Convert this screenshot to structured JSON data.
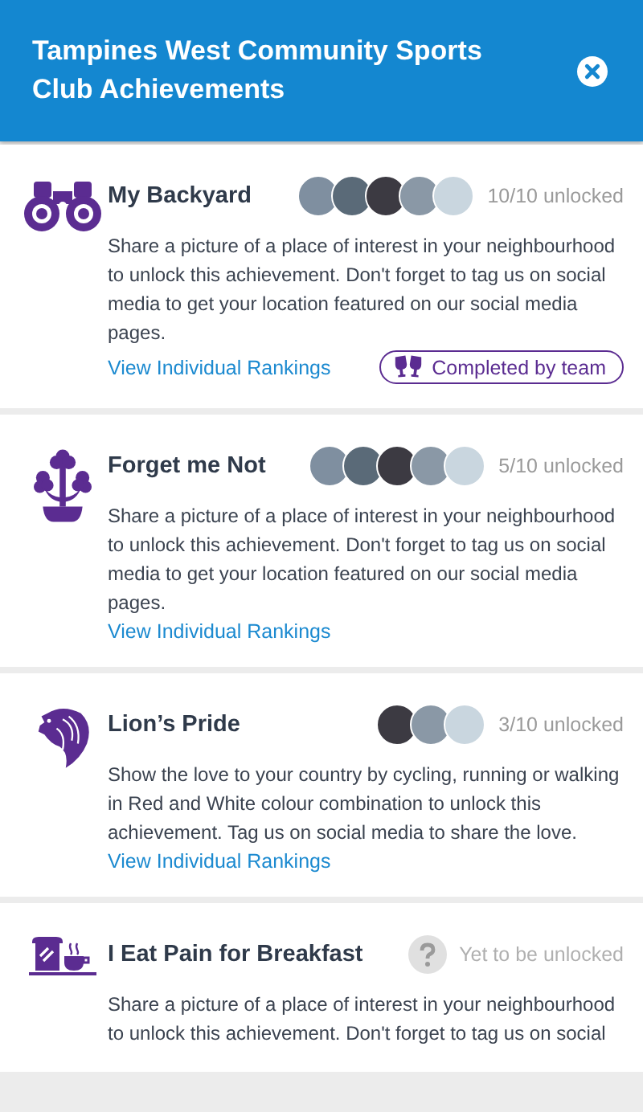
{
  "header": {
    "title": "Tampines West Community Sports Club Achievements"
  },
  "achievements": [
    {
      "kind": "binoculars",
      "title": "My Backyard",
      "avatars": [
        {
          "kind": "photo"
        },
        {
          "kind": "photo"
        },
        {
          "kind": "photo"
        },
        {
          "kind": "photo"
        },
        {
          "kind": "photo"
        }
      ],
      "status": {
        "kind": "unlocked",
        "text": "10/10 unlocked"
      },
      "description": "Share a picture of a place of interest in your neighbourhood to unlock this achievement. Don't forget to tag us on social media to get your location featured on our social media pages.",
      "link": "View Individual Rankings",
      "badge": "Completed by team"
    },
    {
      "kind": "flower",
      "title": "Forget me Not",
      "avatars": [
        {
          "kind": "photo"
        },
        {
          "kind": "photo"
        },
        {
          "kind": "photo"
        },
        {
          "kind": "photo"
        },
        {
          "kind": "photo"
        }
      ],
      "status": {
        "kind": "unlocked",
        "text": "5/10 unlocked"
      },
      "description": "Share a picture of a place of interest in your neighbourhood to unlock this achievement. Don't forget to tag us on social media to get your location featured on our social media pages.",
      "link": "View Individual Rankings"
    },
    {
      "kind": "lion",
      "title": "Lion’s Pride",
      "avatars": [
        {
          "kind": "photo"
        },
        {
          "kind": "photo"
        },
        {
          "kind": "photo"
        }
      ],
      "status": {
        "kind": "unlocked",
        "text": "3/10 unlocked"
      },
      "description": "Show the love to your country by cycling, running or walking in Red and White colour combination to unlock this achievement. Tag us on social media to share the love.",
      "link": "View Individual Rankings"
    },
    {
      "kind": "breakfast",
      "title": "I Eat Pain for Breakfast",
      "status": {
        "kind": "locked",
        "text": "Yet to be unlocked"
      },
      "description": "Share a picture of a place of interest in your neighbourhood to unlock this achievement. Don't forget to tag us on social"
    }
  ]
}
